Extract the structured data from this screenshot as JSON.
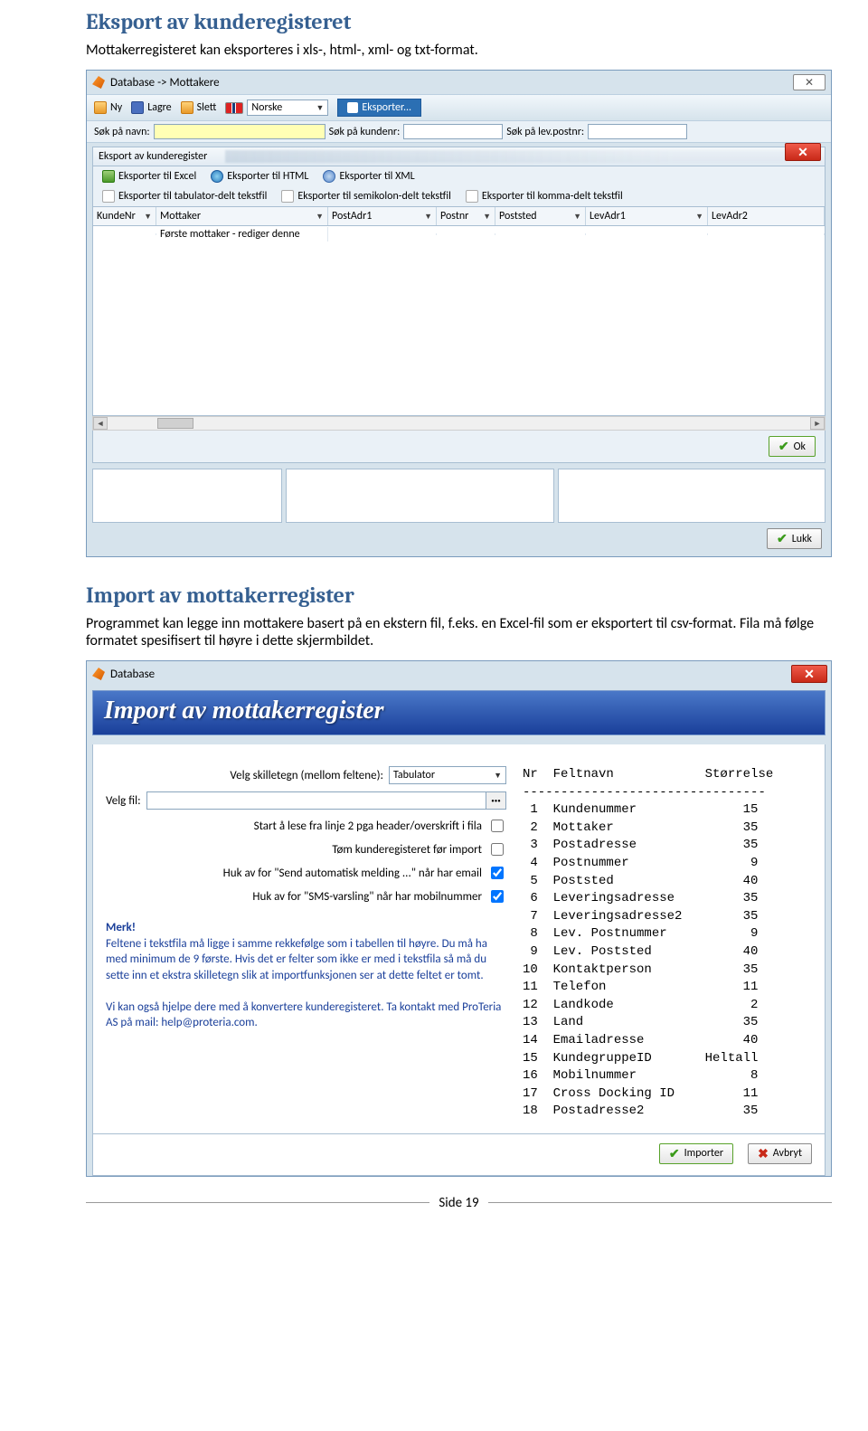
{
  "doc": {
    "h1": "Eksport av kunderegisteret",
    "p1": "Mottakerregisteret kan eksporteres i xls-, html-, xml- og txt-format.",
    "h2": "Import av mottakerregister",
    "p2": "Programmet kan legge inn mottakere basert på en ekstern fil, f.eks. en Excel-fil som er eksportert til csv-format. Fila må følge formatet spesifisert til høyre i dette skjermbildet.",
    "page": "Side 19"
  },
  "win1": {
    "title": "Database -> Mottakere",
    "toolbar": {
      "ny": "Ny",
      "lagre": "Lagre",
      "slett": "Slett",
      "lang": "Norske",
      "export": "Eksporter..."
    },
    "search": {
      "navn": "Søk på navn:",
      "kundenr": "Søk på kundenr:",
      "postnr": "Søk på lev.postnr:"
    },
    "panel_title": "Eksport av kunderegister",
    "exports": {
      "excel": "Eksporter til Excel",
      "html": "Eksporter til HTML",
      "xml": "Eksporter til XML",
      "tab": "Eksporter til tabulator-delt tekstfil",
      "semi": "Eksporter til semikolon-delt tekstfil",
      "komma": "Eksporter til komma-delt tekstfil"
    },
    "cols": [
      "KundeNr",
      "Mottaker",
      "PostAdr1",
      "Postnr",
      "Poststed",
      "LevAdr1",
      "LevAdr2"
    ],
    "first_row": "Første mottaker - rediger denne",
    "ok": "Ok",
    "lukk": "Lukk"
  },
  "win2": {
    "title": "Database",
    "banner": "Import av mottakerregister",
    "form": {
      "skilletegn_label": "Velg skilletegn (mellom feltene):",
      "skilletegn_value": "Tabulator",
      "fil_label": "Velg fil:",
      "c1": "Start å lese fra linje 2 pga header/overskrift i fila",
      "c2": "Tøm kunderegisteret før import",
      "c3": "Huk av for \"Send automatisk melding ...\" når har email",
      "c4": "Huk av for \"SMS-varsling\" når har mobilnummer"
    },
    "merk": {
      "title": "Merk!",
      "p1": "Feltene i tekstfila må ligge i samme rekkefølge som i tabellen til høyre. Du må ha med minimum de 9 første. Hvis det er felter som ikke er med i tekstfila så må du sette inn et ekstra skilletegn slik at importfunksjonen ser at dette feltet er tomt.",
      "p2": "Vi kan også hjelpe dere med å konvertere kunderegisteret. Ta kontakt med ProTeria AS på mail: help@proteria.com."
    },
    "table": {
      "h_nr": "Nr",
      "h_felt": "Feltnavn",
      "h_size": "Størrelse",
      "rows": [
        {
          "nr": "1",
          "name": "Kundenummer",
          "size": "15"
        },
        {
          "nr": "2",
          "name": "Mottaker",
          "size": "35"
        },
        {
          "nr": "3",
          "name": "Postadresse",
          "size": "35"
        },
        {
          "nr": "4",
          "name": "Postnummer",
          "size": "9"
        },
        {
          "nr": "5",
          "name": "Poststed",
          "size": "40"
        },
        {
          "nr": "6",
          "name": "Leveringsadresse",
          "size": "35"
        },
        {
          "nr": "7",
          "name": "Leveringsadresse2",
          "size": "35"
        },
        {
          "nr": "8",
          "name": "Lev. Postnummer",
          "size": "9"
        },
        {
          "nr": "9",
          "name": "Lev. Poststed",
          "size": "40"
        },
        {
          "nr": "10",
          "name": "Kontaktperson",
          "size": "35"
        },
        {
          "nr": "11",
          "name": "Telefon",
          "size": "11"
        },
        {
          "nr": "12",
          "name": "Landkode",
          "size": "2"
        },
        {
          "nr": "13",
          "name": "Land",
          "size": "35"
        },
        {
          "nr": "14",
          "name": "Emailadresse",
          "size": "40"
        },
        {
          "nr": "15",
          "name": "KundegruppeID",
          "size": "Heltall"
        },
        {
          "nr": "16",
          "name": "Mobilnummer",
          "size": "8"
        },
        {
          "nr": "17",
          "name": "Cross Docking ID",
          "size": "11"
        },
        {
          "nr": "18",
          "name": "Postadresse2",
          "size": "35"
        }
      ]
    },
    "importer": "Importer",
    "avbryt": "Avbryt"
  }
}
